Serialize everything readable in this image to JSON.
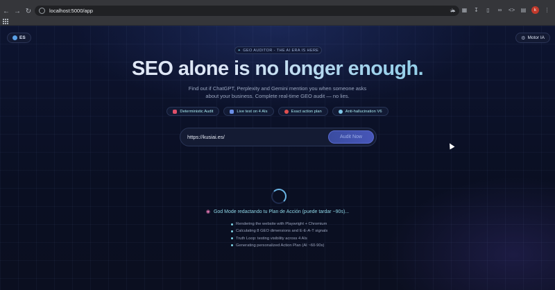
{
  "browser": {
    "url": "localhost:5000/app"
  },
  "page": {
    "language_label": "ES",
    "motor_label": "Motor IA",
    "eyebrow": "GEO AUDITOR - THE AI ERA IS HERE",
    "headline": "SEO alone is no longer enough.",
    "subtitle": "Find out if ChatGPT, Perplexity and Gemini mention you when someone asks about your business. Complete real-time GEO audit — no lies.",
    "features": [
      {
        "label": "Deterministic Audit",
        "icon": "lightning-icon",
        "color": "#e0506a"
      },
      {
        "label": "Live test on 4 AIs",
        "icon": "chart-icon",
        "color": "#6a8ee6"
      },
      {
        "label": "Exact action plan",
        "icon": "target-icon",
        "color": "#e05050"
      },
      {
        "label": "Anti-hallucination V6",
        "icon": "magnifier-icon",
        "color": "#7fc6e6"
      }
    ],
    "search": {
      "value": "https://kusiai.es/",
      "button_label": "Audit Now"
    },
    "status_text": "God Mode redactando tu Plan de Acción (puede tardar ~90s)...",
    "steps": [
      "Rendering the website with Playwright + Chromium",
      "Calculating 8 GEO dimensions and E-E-A-T signals",
      "Truth Loop: testing visibility across 4 AIs",
      "Generating personalized Action Plan (AI ~60-90s)"
    ]
  }
}
